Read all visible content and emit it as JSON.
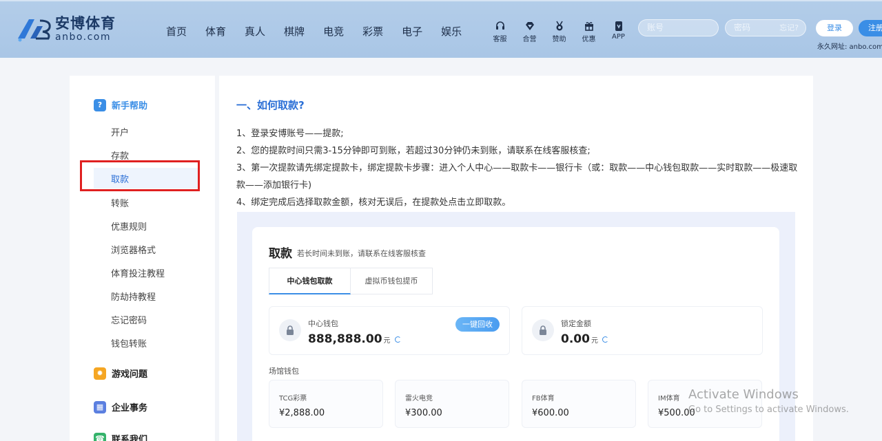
{
  "header": {
    "logo_cn": "安博体育",
    "logo_en": "anbo.com",
    "nav": [
      "首页",
      "体育",
      "真人",
      "棋牌",
      "电竞",
      "彩票",
      "电子",
      "娱乐"
    ],
    "icons": [
      {
        "label": "客服",
        "icon": "headset-icon"
      },
      {
        "label": "合营",
        "icon": "diamond-icon"
      },
      {
        "label": "赞助",
        "icon": "medal-icon"
      },
      {
        "label": "优惠",
        "icon": "gift-icon"
      },
      {
        "label": "APP",
        "icon": "phone-icon"
      }
    ],
    "account_placeholder": "账号",
    "password_placeholder": "密码",
    "forgot": "忘记?",
    "login": "登录",
    "register": "注册",
    "permanent_url": "永久网址: anbo.com"
  },
  "sidebar": {
    "sections": [
      {
        "title": "新手帮助",
        "items": [
          "开户",
          "存款",
          "取款",
          "转账",
          "优惠规则",
          "浏览器格式",
          "体育投注教程",
          "防劫持教程",
          "忘记密码",
          "钱包转账"
        ]
      },
      {
        "title": "游戏问题"
      },
      {
        "title": "企业事务"
      },
      {
        "title": "联系我们"
      }
    ],
    "active": "取款"
  },
  "content": {
    "heading": "一、如何取款?",
    "steps": [
      "1、登录安博账号——提款;",
      "2、您的提款时间只需3-15分钟即可到账，若超过30分钟仍未到账，请联系在线客服核查;",
      "3、第一次提款请先绑定提款卡，绑定提款卡步骤：进入个人中心——取款卡——银行卡（或：取款——中心钱包取款——实时取款——极速取款——添加银行卡)",
      "4、绑定完成后选择取款金额，核对无误后，在提款处点击立即取款。"
    ],
    "panel": {
      "title": "取款",
      "subtitle": "若长时间未到账，请联系在线客服核查",
      "tabs": [
        "中心钱包取款",
        "虚拟币钱包提币"
      ],
      "center_wallet": {
        "label": "中心钱包",
        "amount": "888,888.00",
        "unit": "元",
        "recall": "一键回收"
      },
      "locked": {
        "label": "锁定金额",
        "amount": "0.00",
        "unit": "元"
      },
      "venue_label": "场馆钱包",
      "venues": [
        {
          "name": "TCG彩票",
          "amount": "¥2,888.00"
        },
        {
          "name": "雷火电竞",
          "amount": "¥300.00"
        },
        {
          "name": "FB体育",
          "amount": "¥600.00"
        },
        {
          "name": "IM体育",
          "amount": "¥500.00"
        }
      ]
    }
  },
  "watermark": {
    "title": "Activate Windows",
    "sub": "Go to Settings to activate Windows."
  },
  "colors": {
    "accent": "#2b6fd6",
    "header": "#b3cde9",
    "highlight_box": "#e02020"
  }
}
